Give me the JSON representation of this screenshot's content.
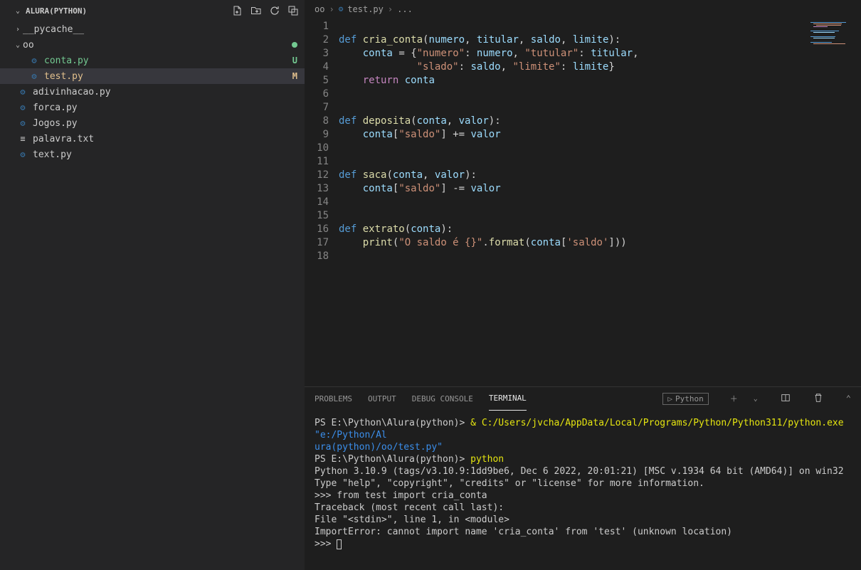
{
  "sidebar": {
    "title": "ALURA(PYTHON)",
    "folders": [
      {
        "name": "__pycache__",
        "expanded": false,
        "depth": 1
      },
      {
        "name": "oo",
        "expanded": true,
        "depth": 1,
        "dot": true
      }
    ],
    "ooChildren": [
      {
        "name": "conta.py",
        "status": "U",
        "type": "py"
      },
      {
        "name": "test.py",
        "status": "M",
        "type": "py",
        "selected": true
      }
    ],
    "rootFiles": [
      {
        "name": "adivinhacao.py",
        "type": "py"
      },
      {
        "name": "forca.py",
        "type": "py"
      },
      {
        "name": "Jogos.py",
        "type": "py"
      },
      {
        "name": "palavra.txt",
        "type": "txt"
      },
      {
        "name": "text.py",
        "type": "py"
      }
    ]
  },
  "breadcrumb": {
    "seg1": "oo",
    "seg2": "test.py",
    "seg3": "..."
  },
  "panel": {
    "tabs": [
      "PROBLEMS",
      "OUTPUT",
      "DEBUG CONSOLE",
      "TERMINAL"
    ],
    "active": 3,
    "termName": "Python"
  },
  "terminal": {
    "l1a": "PS E:\\Python\\Alura(python)> ",
    "l1b": "& ",
    "l1c": "C:/Users/jvcha/AppData/Local/Programs/Python/Python311/python.exe ",
    "l1d": "\"e:/Python/Al",
    "l2": "ura(python)/oo/test.py\"",
    "l3a": "PS E:\\Python\\Alura(python)> ",
    "l3b": "python",
    "l4": "Python 3.10.9 (tags/v3.10.9:1dd9be6, Dec  6 2022, 20:01:21) [MSC v.1934 64 bit (AMD64)] on win32",
    "l5": "Type \"help\", \"copyright\", \"credits\" or \"license\" for more information.",
    "l6": ">>> from test import cria_conta",
    "l7": "Traceback (most recent call last):",
    "l8": "  File \"<stdin>\", line 1, in <module>",
    "l9": "ImportError: cannot import name 'cria_conta' from 'test' (unknown location)",
    "l10": ">>> "
  },
  "code": {
    "lines": 18
  }
}
